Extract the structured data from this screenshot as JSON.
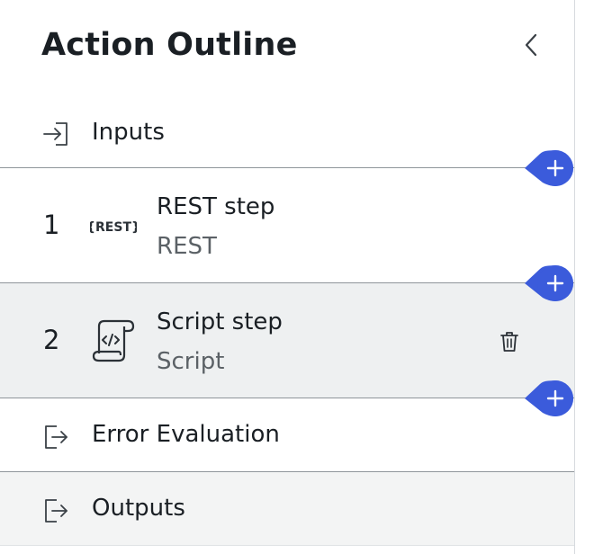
{
  "header": {
    "title": "Action Outline",
    "collapse_icon": "chevron-left-icon"
  },
  "outline": {
    "inputs": {
      "label": "Inputs",
      "icon": "sign-in-icon"
    },
    "steps": [
      {
        "number": "1",
        "name": "REST step",
        "type": "REST",
        "icon": "rest-icon",
        "icon_text": "{REST}"
      },
      {
        "number": "2",
        "name": "Script step",
        "type": "Script",
        "icon": "script-scroll-icon",
        "selected": true
      }
    ],
    "error_evaluation": {
      "label": "Error Evaluation",
      "icon": "sign-out-icon"
    },
    "outputs": {
      "label": "Outputs",
      "icon": "sign-out-icon"
    }
  },
  "colors": {
    "accent": "#3b5bdb",
    "selected_row": "#eef0f1",
    "divider": "#8f959a"
  }
}
